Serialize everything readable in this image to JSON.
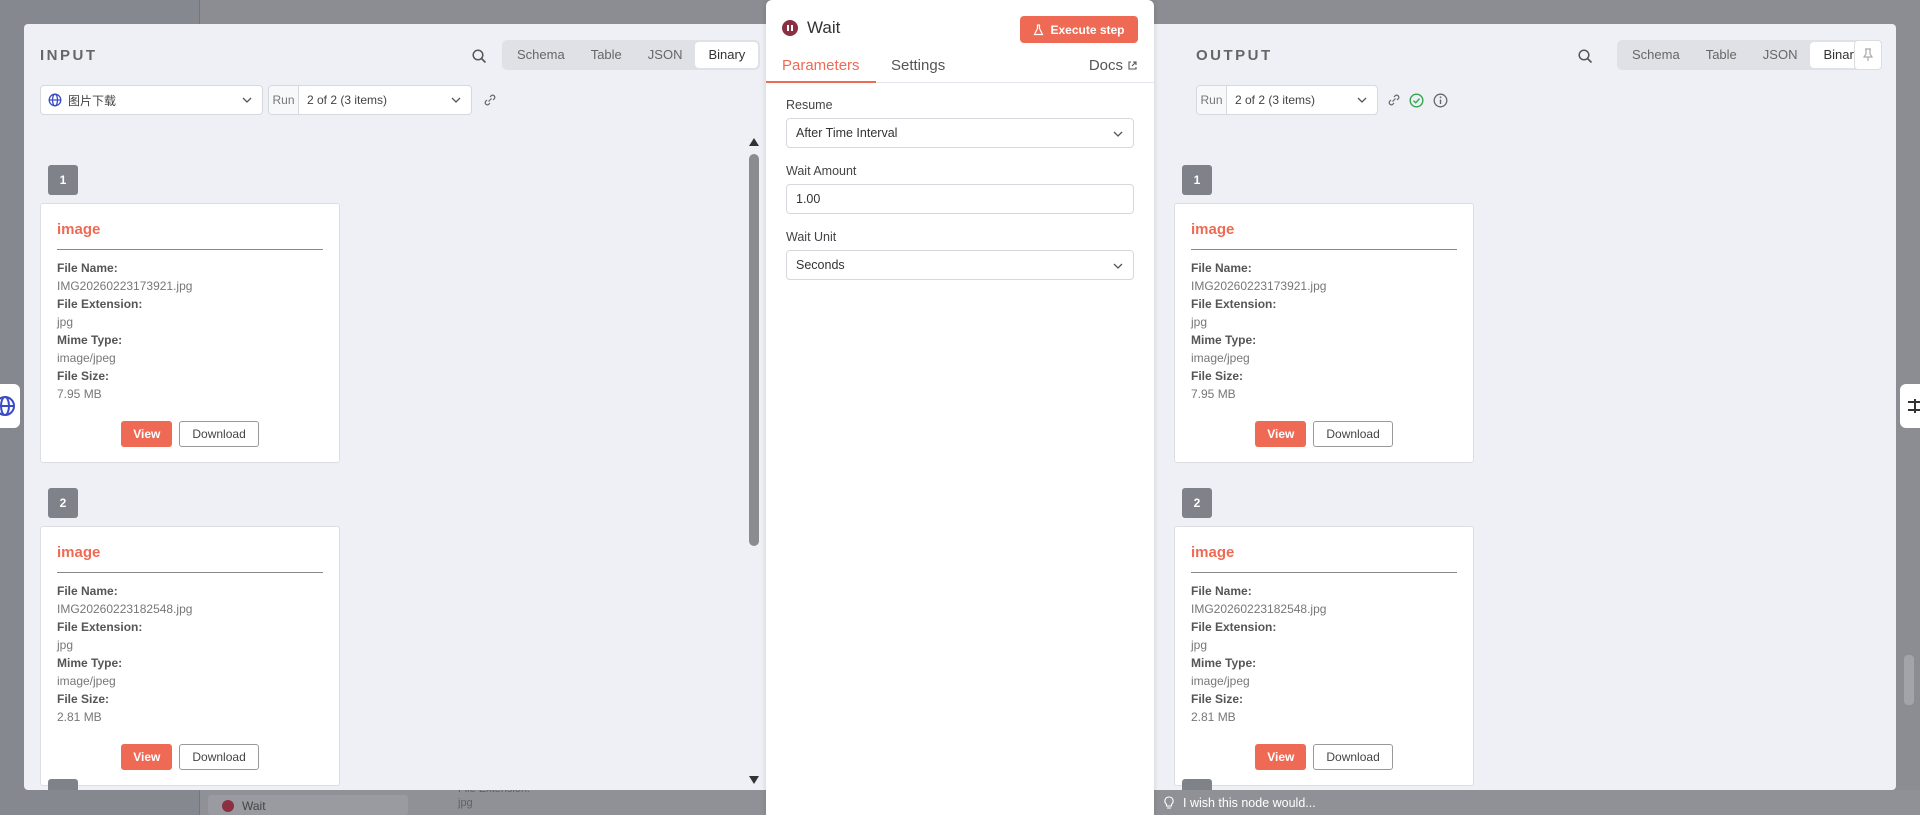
{
  "input_panel": {
    "title": "INPUT",
    "view_tabs": [
      "Schema",
      "Table",
      "JSON",
      "Binary"
    ],
    "active_view": "Binary",
    "node_select": "图片下载",
    "run_label": "Run",
    "run_value": "2 of 2 (3 items)"
  },
  "output_panel": {
    "title": "OUTPUT",
    "view_tabs": [
      "Schema",
      "Table",
      "JSON",
      "Binary"
    ],
    "active_view": "Binary",
    "run_label": "Run",
    "run_value": "2 of 2 (3 items)"
  },
  "items": [
    {
      "index": "1",
      "title": "image",
      "file_name_label": "File Name:",
      "file_name": "IMG20260223173921.jpg",
      "file_extension_label": "File Extension:",
      "file_extension": "jpg",
      "mime_type_label": "Mime Type:",
      "mime_type": "image/jpeg",
      "file_size_label": "File Size:",
      "file_size": "7.95 MB",
      "view_label": "View",
      "download_label": "Download"
    },
    {
      "index": "2",
      "title": "image",
      "file_name_label": "File Name:",
      "file_name": "IMG20260223182548.jpg",
      "file_extension_label": "File Extension:",
      "file_extension": "jpg",
      "mime_type_label": "Mime Type:",
      "mime_type": "image/jpeg",
      "file_size_label": "File Size:",
      "file_size": "2.81 MB",
      "view_label": "View",
      "download_label": "Download"
    }
  ],
  "node": {
    "name": "Wait",
    "execute_label": "Execute step",
    "tabs": [
      "Parameters",
      "Settings"
    ],
    "active_tab": "Parameters",
    "docs_label": "Docs",
    "params": {
      "resume_label": "Resume",
      "resume_value": "After Time Interval",
      "amount_label": "Wait Amount",
      "amount_value": "1.00",
      "unit_label": "Wait Unit",
      "unit_value": "Seconds"
    }
  },
  "feedback": {
    "text": "I wish this node would..."
  },
  "background": {
    "wait_node": "Wait",
    "faded_text_1": "File Extension:",
    "faded_text_2": "jpg"
  },
  "colors": {
    "accent": "#ef6a54",
    "node_icon": "#8a3040",
    "success": "#2ea84a"
  }
}
